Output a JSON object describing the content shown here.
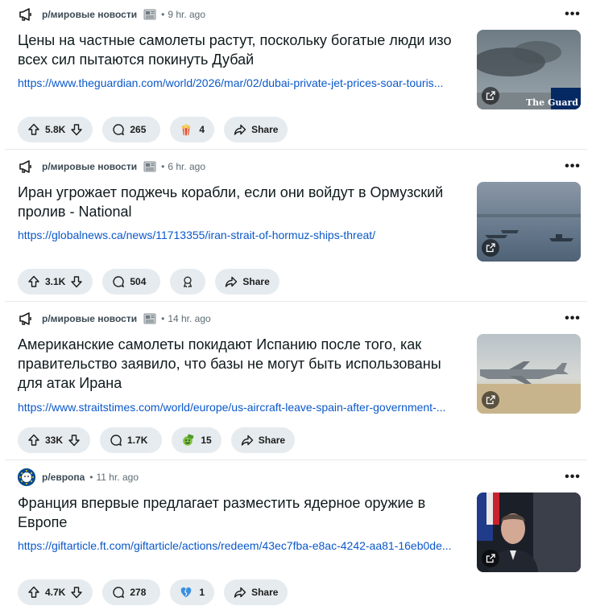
{
  "posts": [
    {
      "subreddit": "р/мировые новости",
      "separator": "•",
      "time": "9 hr. ago",
      "title": "Цены на частные самолеты растут, поскольку богатые люди изо всех сил пытаются покинуть Дубай",
      "link": "https://www.theguardian.com/world/2026/mar/02/dubai-private-jet-prices-soar-touris...",
      "thumb_brand": "The Guard",
      "votes": "5.8K",
      "comments": "265",
      "award_count": "4",
      "award_icon": "popcorn-icon",
      "share": "Share"
    },
    {
      "subreddit": "р/мировые новости",
      "separator": "•",
      "time": "6 hr. ago",
      "title": "Иран угрожает поджечь корабли, если они войдут в Ормузский пролив - National",
      "link": "https://globalnews.ca/news/11713355/iran-strait-of-hormuz-ships-threat/",
      "votes": "3.1K",
      "comments": "504",
      "award_count": "",
      "award_icon": "award-icon",
      "share": "Share"
    },
    {
      "subreddit": "р/мировые новости",
      "separator": "•",
      "time": "14 hr. ago",
      "title": "Американские самолеты покидают Испанию после того, как правительство заявило, что базы не могут быть использованы для атак Ирана",
      "link": "https://www.straitstimes.com/world/europe/us-aircraft-leave-spain-after-government-...",
      "votes": "33K",
      "comments": "1.7K",
      "award_count": "15",
      "award_icon": "money-face-icon",
      "share": "Share"
    },
    {
      "subreddit": "р/европа",
      "separator": "•",
      "time": "11 hr. ago",
      "title": "Франция впервые предлагает разместить ядерное оружие в Европе",
      "link": "https://giftarticle.ft.com/giftarticle/actions/redeem/43ec7fba-e8ac-4242-aa81-16eb0de...",
      "votes": "4.7K",
      "comments": "278",
      "award_count": "1",
      "award_icon": "broken-heart-icon",
      "share": "Share"
    }
  ],
  "colors": {
    "link": "#0a58ca",
    "pill_bg": "#e5ebee",
    "divider": "#e5e8ea"
  }
}
